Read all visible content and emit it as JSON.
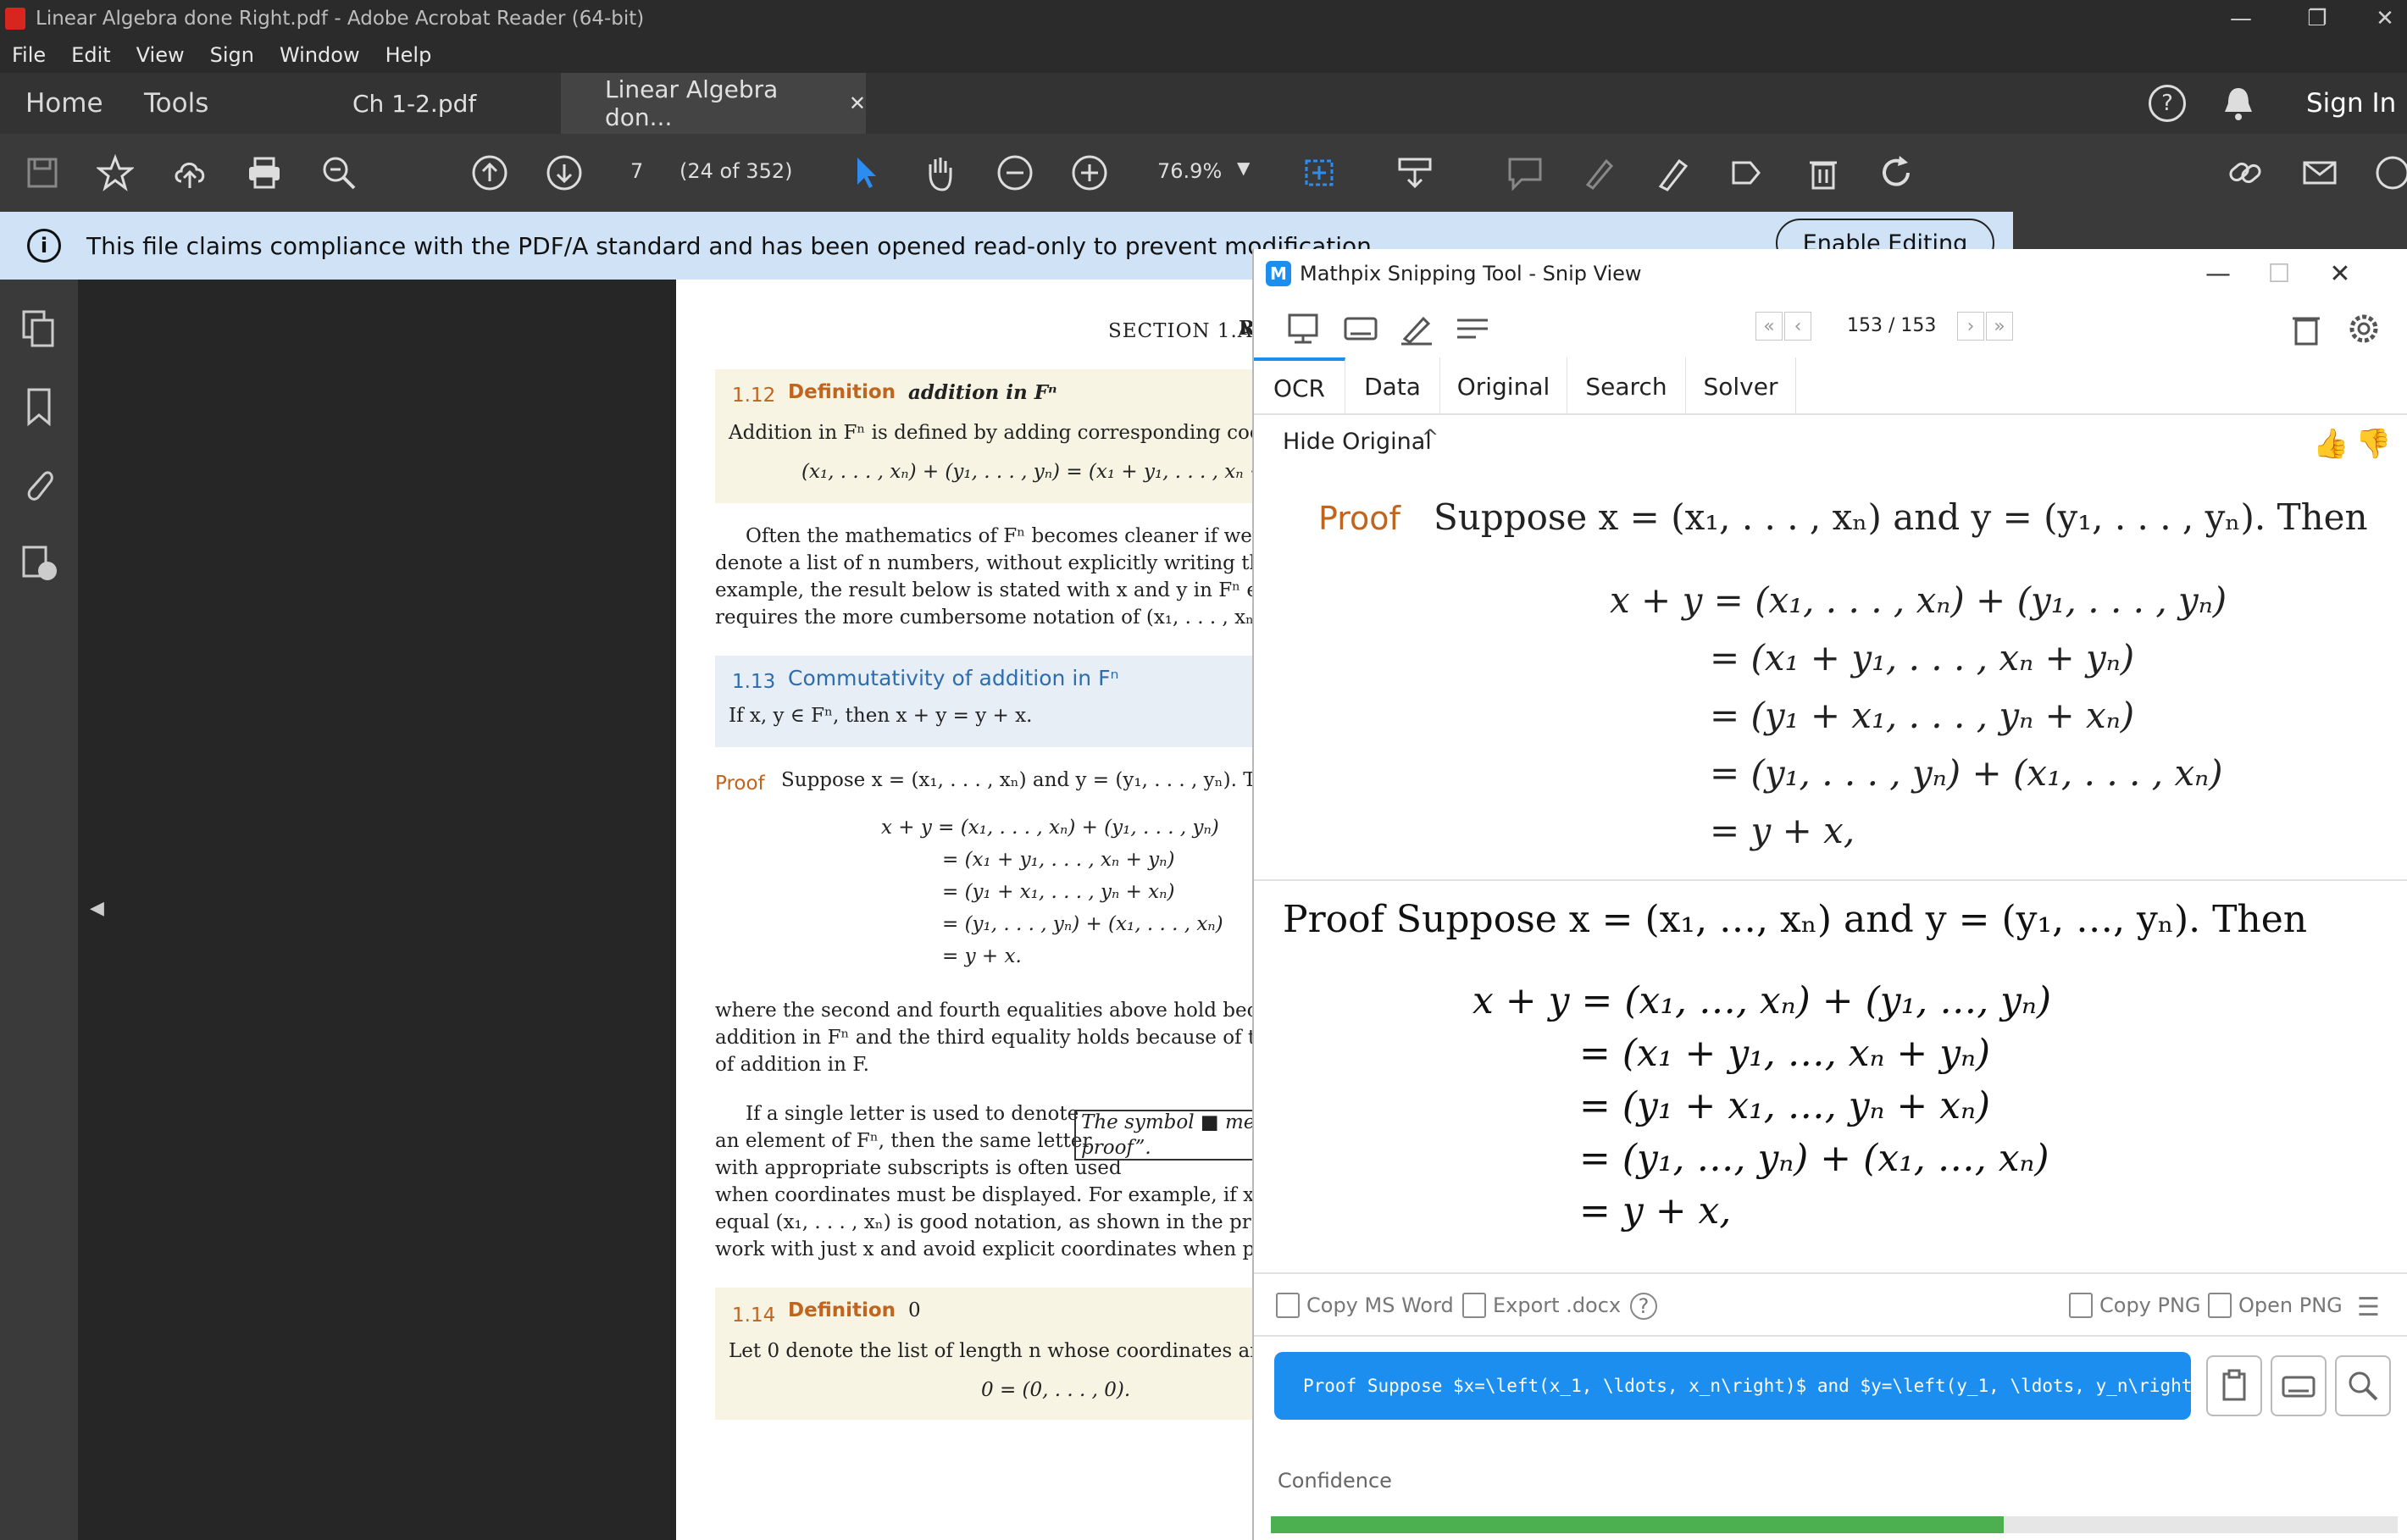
{
  "window": {
    "title": "Linear Algebra done Right.pdf - Adobe Acrobat Reader (64-bit)"
  },
  "menu": [
    "File",
    "Edit",
    "View",
    "Sign",
    "Window",
    "Help"
  ],
  "tabs": {
    "home": "Home",
    "tools": "Tools",
    "doc1": "Ch 1-2.pdf",
    "doc2": "Linear Algebra don...",
    "sign_in": "Sign In"
  },
  "toolbar": {
    "page_number": "7",
    "page_of": "(24 of 352)",
    "zoom": "76.9%"
  },
  "infobar": {
    "message": "This file claims compliance with the PDF/A standard and has been opened read-only to prevent modification.",
    "enable_editing": "Enable Editing"
  },
  "pdf": {
    "section_header": "SECTION 1.A",
    "section_header_tail": "R",
    "def112": {
      "num": "1.12",
      "label": "Definition",
      "title": "addition in Fⁿ",
      "body": "Addition in Fⁿ is defined by adding corresponding coordina",
      "eq": "(x₁, . . . , xₙ) + (y₁, . . . , yₙ) = (x₁ + y₁, . . . , xₙ +"
    },
    "para1": [
      "Often the mathematics of Fⁿ becomes cleaner if we use a",
      "denote a list of n numbers, without explicitly writing the co",
      "example, the result below is stated with x and y in Fⁿ even th",
      "requires the more cumbersome notation of (x₁, . . . , xₙ) and ("
    ],
    "thm113": {
      "num": "1.13",
      "title": "Commutativity of addition in Fⁿ",
      "body": "If x, y ∈ Fⁿ, then x + y = y + x."
    },
    "proof_label": "Proof",
    "proof_line": "Suppose x = (x₁, . . . , xₙ) and y = (y₁, . . . , yₙ). The",
    "eqs": [
      "x + y = (x₁, . . . , xₙ) + (y₁, . . . , yₙ)",
      "= (x₁ + y₁, . . . , xₙ + yₙ)",
      "= (y₁ + x₁, . . . , yₙ + xₙ)",
      "= (y₁, . . . , yₙ) + (x₁, . . . , xₙ)",
      "= y + x."
    ],
    "para2": [
      "where the second and fourth equalities above hold because of th",
      "addition in Fⁿ and the third equality holds because of the usual",
      "of addition in F."
    ],
    "para3": [
      "If a single letter is used to denote",
      "an element of Fⁿ, then the same letter",
      "with appropriate subscripts is often used",
      "when coordinates must be displayed. For example, if x ∈ Fⁿ",
      "equal (x₁, . . . , xₙ) is good notation, as shown in the proof abo",
      "work with just x and avoid explicit coordinates when possible"
    ],
    "margin_note": [
      "The symbol ■ means",
      "proof”."
    ],
    "def114": {
      "num": "1.14",
      "label": "Definition",
      "title": "0",
      "body": "Let 0 denote the list of length n whose coordinates are all 0:",
      "eq": "0 = (0, . . . , 0)."
    }
  },
  "mathpix": {
    "title": "Mathpix Snipping Tool - Snip View",
    "pager": "153 / 153",
    "tabs": [
      "OCR",
      "Data",
      "Original",
      "Search",
      "Solver"
    ],
    "hide_original": "Hide Original",
    "original": {
      "proof_label": "Proof",
      "line": "Suppose x = (x₁, . . . , xₙ) and y = (y₁, . . . , yₙ). Then",
      "eqs": [
        "x + y = (x₁, . . . , xₙ) + (y₁, . . . , yₙ)",
        "= (x₁ + y₁, . . . , xₙ + yₙ)",
        "= (y₁ + x₁, . . . , yₙ + xₙ)",
        "= (y₁, . . . , yₙ) + (x₁, . . . , xₙ)",
        "= y + x,"
      ]
    },
    "rendered": {
      "line": "Proof Suppose x = (x₁, …, xₙ) and y = (y₁, …, yₙ). Then",
      "eqs": [
        "x + y = (x₁, …, xₙ) + (y₁, …, yₙ)",
        "= (x₁ + y₁, …, xₙ + yₙ)",
        "= (y₁ + x₁, …, yₙ + xₙ)",
        "= (y₁, …, yₙ) + (x₁, …, xₙ)",
        "= y + x,"
      ]
    },
    "actions": {
      "copy_ms_word": "Copy MS Word",
      "export_docx": "Export .docx",
      "copy_png": "Copy PNG",
      "open_png": "Open PNG"
    },
    "latex": "Proof Suppose $x=\\left(x_1, \\ldots, x_n\\right)$ and $y=\\left(y_1, \\ldots, y_n\\right)$",
    "confidence_label": "Confidence",
    "confidence": 0.65
  },
  "colors": {
    "accent": "#1b8ef0",
    "definition_orange": "#c0641e",
    "theorem_blue": "#2c6db0",
    "confidence_green": "#4caf50"
  }
}
